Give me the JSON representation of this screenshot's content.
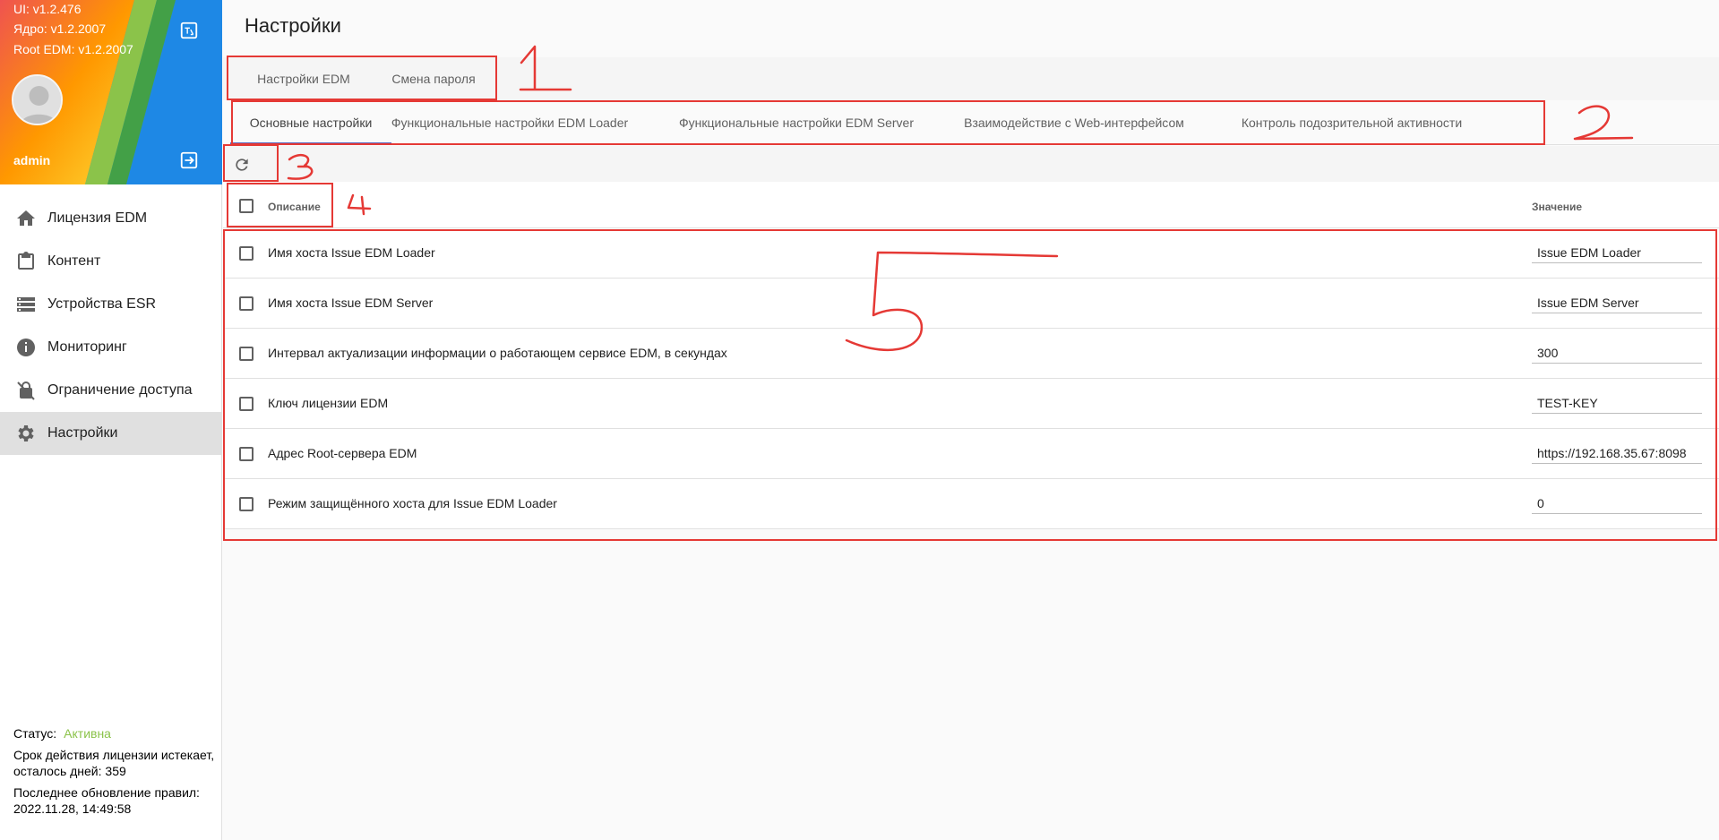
{
  "sidebar": {
    "versions": {
      "ui": "UI: v1.2.476",
      "core": "Ядро: v1.2.2007",
      "root": "Root EDM: v1.2.2007"
    },
    "username": "admin",
    "nav": [
      {
        "label": "Лицензия EDM",
        "icon": "home-icon"
      },
      {
        "label": "Контент",
        "icon": "clipboard-icon"
      },
      {
        "label": "Устройства ESR",
        "icon": "server-list-icon"
      },
      {
        "label": "Мониторинг",
        "icon": "info-icon"
      },
      {
        "label": "Ограничение доступа",
        "icon": "lock-off-icon"
      },
      {
        "label": "Настройки",
        "icon": "gear-icon"
      }
    ],
    "footer": {
      "status_label": "Статус:",
      "status_value": "Активна",
      "license_text": "Срок действия лицензии истекает, осталось дней: 359",
      "update_text": "Последнее обновление правил: 2022.11.28, 14:49:58"
    }
  },
  "main": {
    "title": "Настройки",
    "tabs": [
      {
        "label": "Настройки EDM"
      },
      {
        "label": "Смена пароля"
      }
    ],
    "sub_tabs": [
      {
        "label": "Основные настройки"
      },
      {
        "label": "Функциональные настройки EDM Loader"
      },
      {
        "label": "Функциональные настройки EDM Server"
      },
      {
        "label": "Взаимодействие с Web-интерфейсом"
      },
      {
        "label": "Контроль подозрительной активности"
      }
    ],
    "table": {
      "col_description": "Описание",
      "col_value": "Значение",
      "rows": [
        {
          "description": "Имя хоста Issue EDM Loader",
          "value": "Issue EDM Loader"
        },
        {
          "description": "Имя хоста Issue EDM Server",
          "value": "Issue EDM Server"
        },
        {
          "description": "Интервал актуализации информации о работающем сервисе EDM, в секундах",
          "value": "300"
        },
        {
          "description": "Ключ лицензии EDM",
          "value": "TEST-KEY"
        },
        {
          "description": "Адрес Root-сервера EDM",
          "value": "https://192.168.35.67:8098"
        },
        {
          "description": "Режим защищённого хоста для Issue EDM Loader",
          "value": "0"
        }
      ]
    }
  },
  "colors": {
    "accent": "#5c6bc0",
    "status_active": "#8bc34a",
    "annotation": "#e53935"
  }
}
